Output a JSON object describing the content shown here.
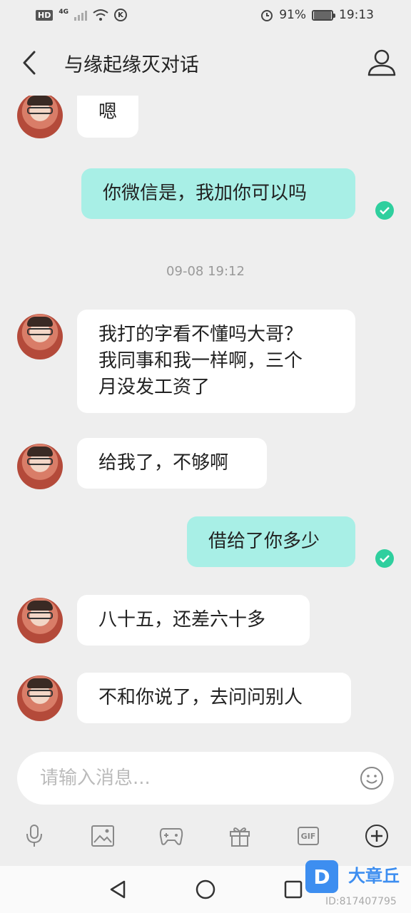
{
  "status_bar": {
    "hd": "HD",
    "network": "4G",
    "battery_percent": "91%",
    "battery_level": 0.91,
    "time": "19:13"
  },
  "header": {
    "title": "与缘起缘灭对话",
    "back_icon": "chevron-left-icon",
    "profile_icon": "person-icon"
  },
  "messages": [
    {
      "direction": "in",
      "text": "嗯"
    },
    {
      "direction": "out",
      "text": "你微信是，我加你可以吗",
      "status": "read"
    },
    {
      "type": "timestamp",
      "text": "09-08 19:12"
    },
    {
      "direction": "in",
      "lines": [
        "我打的字看不懂吗大哥？",
        "我同事和我一样啊，三个",
        "月没发工资了"
      ]
    },
    {
      "direction": "in",
      "text": "给我了，不够啊"
    },
    {
      "direction": "out",
      "text": "借给了你多少",
      "status": "read"
    },
    {
      "direction": "in",
      "text": "八十五，还差六十多"
    },
    {
      "direction": "in",
      "text": "不和你说了，去问问别人"
    }
  ],
  "input": {
    "placeholder": "请输入消息..."
  },
  "toolbar": {
    "items": [
      "microphone-icon",
      "image-icon",
      "gamepad-icon",
      "gift-icon",
      "gif-icon",
      "plus-circle-icon"
    ],
    "gif_label": "GIF"
  },
  "watermark": {
    "logo_letter": "D",
    "brand": "大章丘",
    "id_text": "ID:817407795"
  },
  "colors": {
    "background": "#eeeeee",
    "incoming_bubble": "#ffffff",
    "outgoing_bubble": "#a8efe6",
    "read_check": "#2fcf9e",
    "watermark": "#3d8ef0"
  }
}
